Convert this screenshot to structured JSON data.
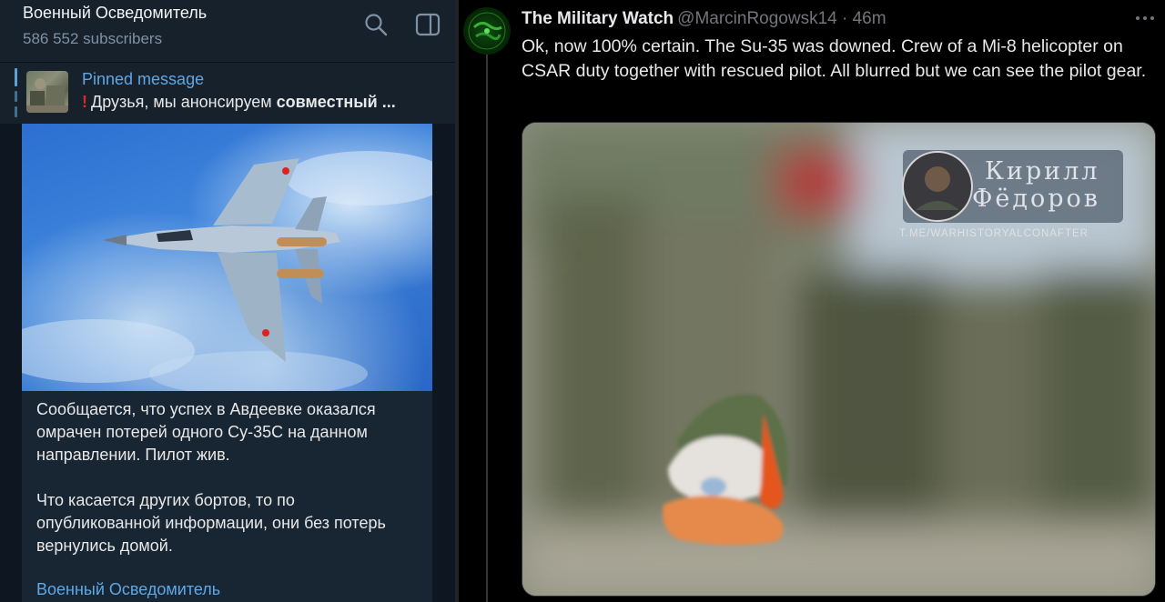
{
  "telegram": {
    "channel_title": "Военный Осведомитель",
    "subscribers": "586 552 subscribers",
    "search_icon": "search-icon",
    "sidebar_icon": "sidebar-toggle-icon",
    "pinned": {
      "label": "Pinned message",
      "text_prefix": "Друзья, мы анонсируем ",
      "text_bold": "совместный ..."
    },
    "post": {
      "paragraph_1": "Сообщается, что успех в Авдеевке оказался омрачен потерей одного Су-35С на данном направлении. Пилот жив.",
      "paragraph_2": "Что касается других бортов, то по опубликованной информации, они без потерь вернулись домой.",
      "signature": "Военный Осведомитель"
    }
  },
  "tweet": {
    "display_name": "The Military Watch",
    "handle_time": "@MarcinRogowsk14 · 46m",
    "body": "Ok, now 100% certain. The Su-35 was downed. Crew of a Mi-8 helicopter on CSAR duty together with rescued pilot. All blurred but we can see the pilot gear.",
    "more_icon": "more-options-icon",
    "watermark": {
      "line_1": "Кирилл",
      "line_2": "Фёдоров",
      "url": "T.ME/WARHISTORYALCONAFTER"
    }
  },
  "colors": {
    "telegram_bg": "#0e1621",
    "telegram_header": "#17212b",
    "telegram_bubble": "#182533",
    "telegram_link": "#5ea8e6",
    "twitter_bg": "#000000",
    "twitter_text": "#e7e9ea",
    "twitter_muted": "#71767b"
  }
}
